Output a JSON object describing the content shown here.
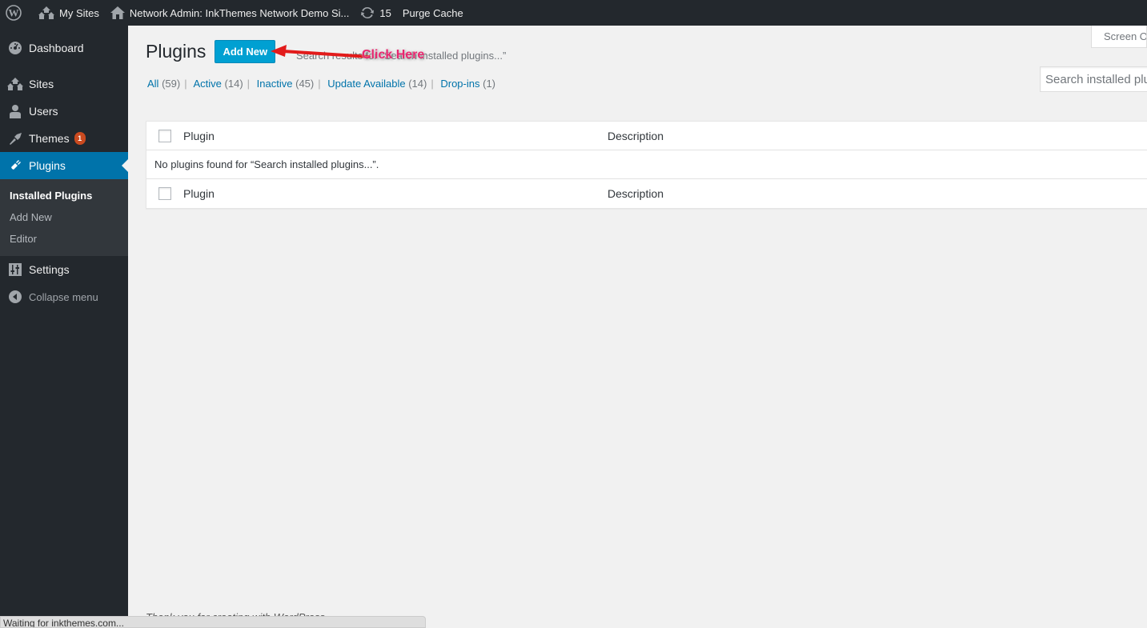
{
  "adminbar": {
    "wp_logo": "wordpress-icon",
    "my_sites": "My Sites",
    "network_admin": "Network Admin: InkThemes Network Demo Si...",
    "updates_count": "15",
    "purge_cache": "Purge Cache"
  },
  "sidebar": {
    "items": [
      {
        "label": "Dashboard",
        "icon": "dashboard-icon"
      },
      {
        "label": "Sites",
        "icon": "sites-icon"
      },
      {
        "label": "Users",
        "icon": "users-icon"
      },
      {
        "label": "Themes",
        "icon": "themes-icon",
        "badge": "1"
      },
      {
        "label": "Plugins",
        "icon": "plugins-icon"
      },
      {
        "label": "Settings",
        "icon": "settings-icon"
      }
    ],
    "submenu": [
      "Installed Plugins",
      "Add New",
      "Editor"
    ],
    "collapse": "Collapse menu"
  },
  "header": {
    "screen_options": "Screen Op",
    "title": "Plugins",
    "add_new": "Add New",
    "subtitle": "Search results for “Search installed plugins...”"
  },
  "filters": [
    {
      "label": "All",
      "count": "(59)"
    },
    {
      "label": "Active",
      "count": "(14)"
    },
    {
      "label": "Inactive",
      "count": "(45)"
    },
    {
      "label": "Update Available",
      "count": "(14)"
    },
    {
      "label": "Drop-ins",
      "count": "(1)"
    }
  ],
  "search": {
    "placeholder": "Search installed plu"
  },
  "table": {
    "col_plugin": "Plugin",
    "col_description": "Description",
    "empty_message": "No plugins found for “Search installed plugins...”."
  },
  "annotation": {
    "label": "Click Here",
    "color": "#e8266e"
  },
  "footer": {
    "thanks": "Thank you for creating with WordPress."
  },
  "statusbar": {
    "text": "Waiting for inkthemes.com..."
  }
}
